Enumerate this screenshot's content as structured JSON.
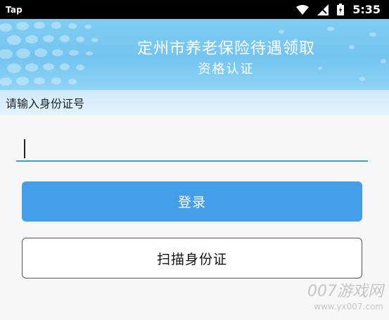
{
  "status_bar": {
    "app_label": "Tap",
    "time": "5:35",
    "icons": [
      "wifi-icon",
      "signal-icon",
      "battery-icon"
    ]
  },
  "header": {
    "title": "定州市养老保险待遇领取",
    "subtitle": "资格认证"
  },
  "form": {
    "prompt": "请输入身份证号",
    "id_value": "",
    "login_label": "登录",
    "scan_label": "扫描身份证"
  },
  "watermark": {
    "brand": "007游戏网",
    "url": "www.yx007.com"
  },
  "colors": {
    "header_bg": "#78c8f2",
    "primary_button": "#449ee8",
    "input_underline": "#3aa0c7",
    "prompt_strip": "#d8eefb"
  }
}
